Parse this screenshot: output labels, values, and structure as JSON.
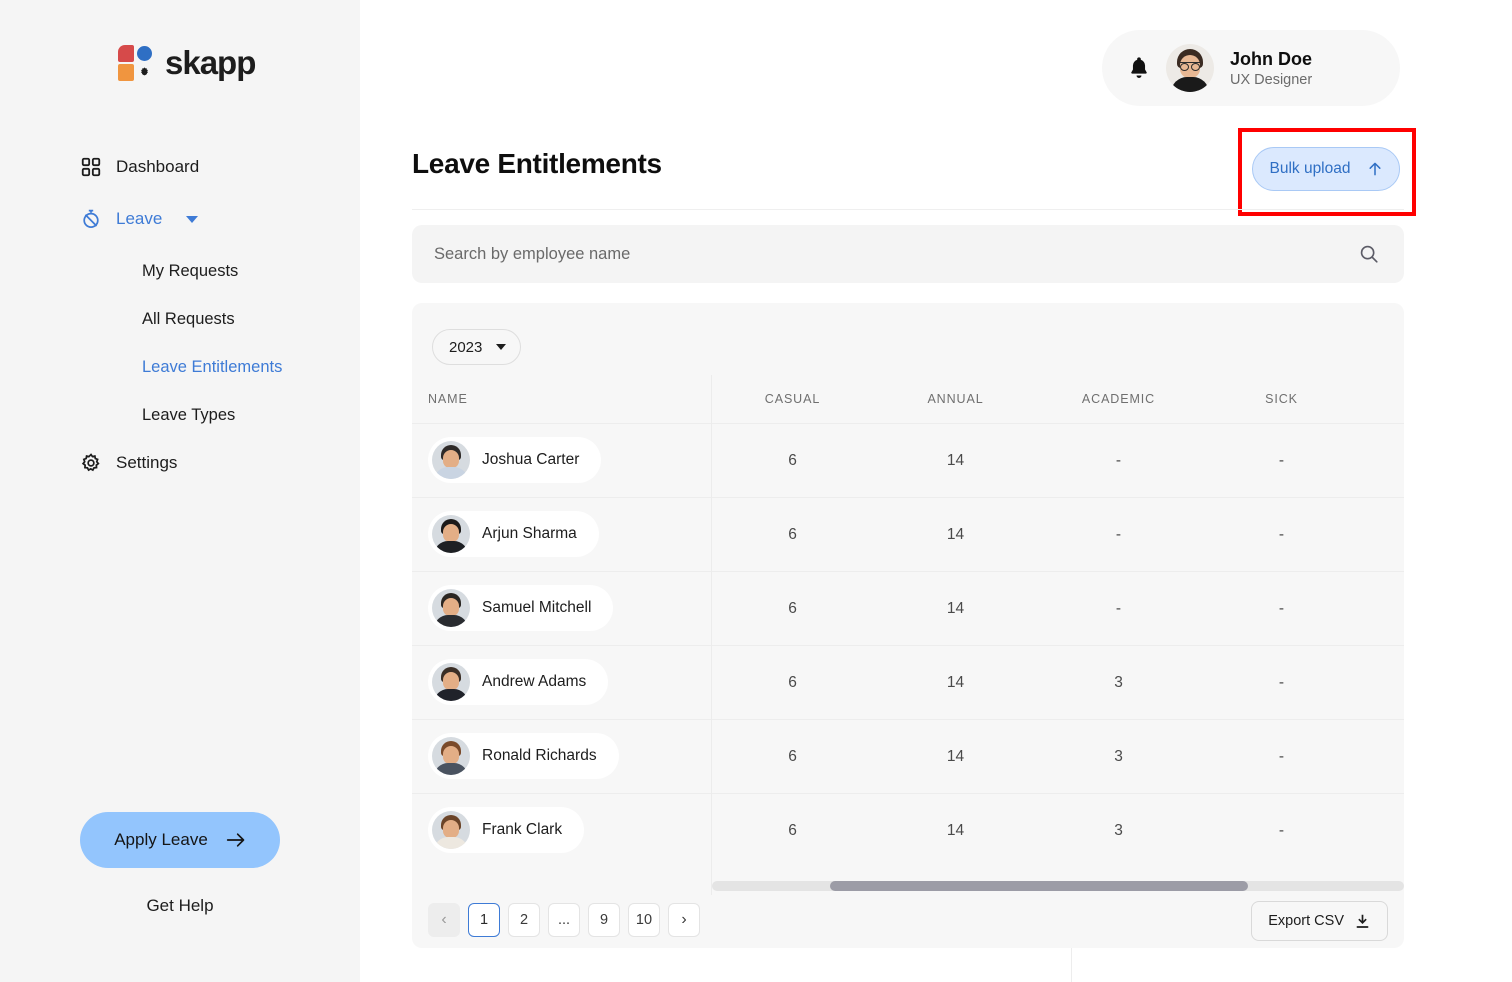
{
  "brand": {
    "name": "skapp",
    "logo_icon": "skapp-logo-icon"
  },
  "sidebar": {
    "items": [
      {
        "label": "Dashboard",
        "icon": "grid-dashboard-icon",
        "active": false
      },
      {
        "label": "Leave",
        "icon": "stopwatch-leave-icon",
        "active": true,
        "expandable": true
      }
    ],
    "sub_items": [
      {
        "label": "My Requests",
        "active": false
      },
      {
        "label": "All Requests",
        "active": false
      },
      {
        "label": "Leave Entitlements",
        "active": true
      },
      {
        "label": "Leave Types",
        "active": false
      }
    ],
    "settings": {
      "label": "Settings",
      "icon": "gear-icon"
    },
    "apply_leave": {
      "label": "Apply Leave",
      "icon": "arrow-right-icon"
    },
    "get_help": {
      "label": "Get Help"
    }
  },
  "header": {
    "notification_icon": "bell-icon",
    "user": {
      "name": "John Doe",
      "role": "UX Designer",
      "avatar": "user-avatar"
    }
  },
  "page": {
    "title": "Leave Entitlements",
    "bulk_upload": {
      "label": "Bulk upload",
      "icon": "arrow-up-icon"
    },
    "highlight_color": "#FF0000"
  },
  "search": {
    "placeholder": "Search by employee name",
    "value": "",
    "icon": "search-icon"
  },
  "table": {
    "year_filter": {
      "value": "2023",
      "icon": "chevron-down-icon"
    },
    "columns": [
      "NAME",
      "CASUAL",
      "ANNUAL",
      "ACADEMIC",
      "SICK"
    ],
    "rows": [
      {
        "name": "Joshua Carter",
        "casual": "6",
        "annual": "14",
        "academic": "-",
        "sick": "-"
      },
      {
        "name": "Arjun Sharma",
        "casual": "6",
        "annual": "14",
        "academic": "-",
        "sick": "-"
      },
      {
        "name": "Samuel Mitchell",
        "casual": "6",
        "annual": "14",
        "academic": "-",
        "sick": "-"
      },
      {
        "name": "Andrew Adams",
        "casual": "6",
        "annual": "14",
        "academic": "3",
        "sick": "-"
      },
      {
        "name": "Ronald Richards",
        "casual": "6",
        "annual": "14",
        "academic": "3",
        "sick": "-"
      },
      {
        "name": "Frank Clark",
        "casual": "6",
        "annual": "14",
        "academic": "3",
        "sick": "-"
      }
    ],
    "export": {
      "label": "Export CSV",
      "icon": "download-icon"
    }
  },
  "pagination": {
    "prev": "‹",
    "next": "›",
    "pages": [
      "1",
      "2",
      "...",
      "9",
      "10"
    ],
    "current": "1"
  },
  "colors": {
    "accent_blue": "#3E7BD6",
    "apply_leave_bg": "#93C5FD",
    "bulk_upload_bg": "#DBE9FE",
    "sidebar_bg": "#F5F5F5",
    "card_bg": "#F7F7F7",
    "highlight": "#FF0000"
  }
}
